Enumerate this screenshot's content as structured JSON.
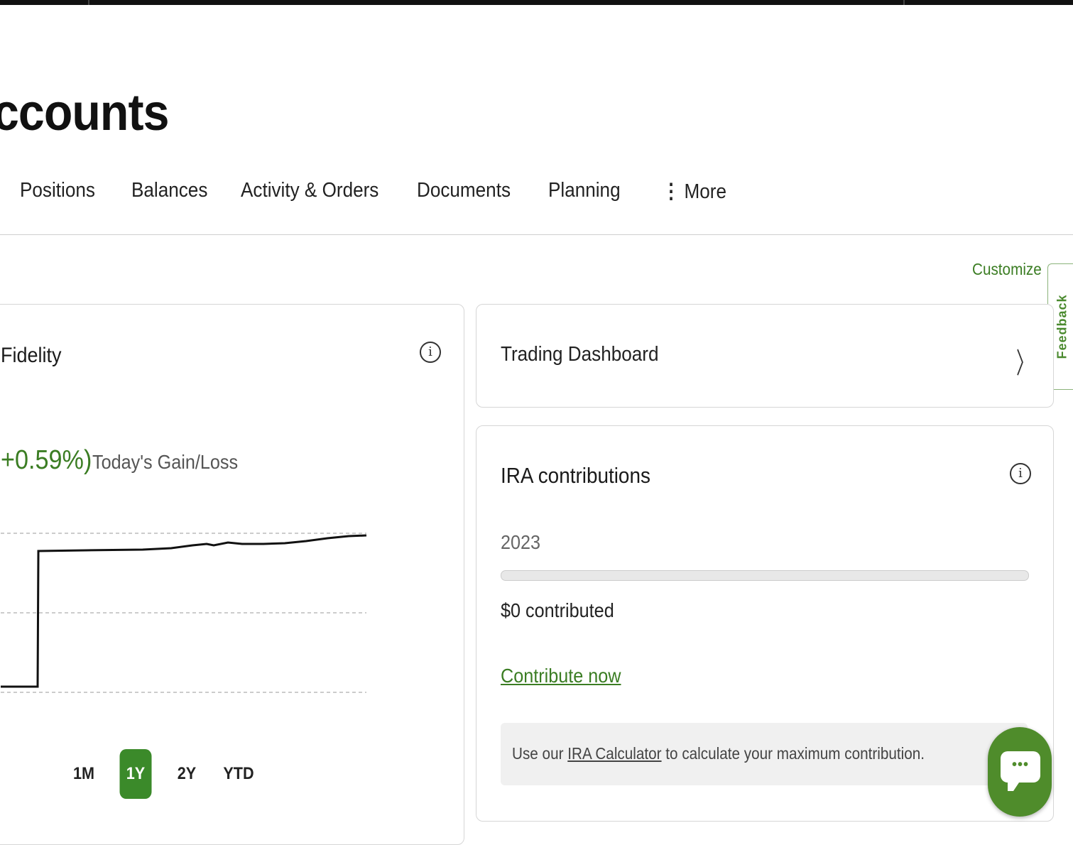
{
  "header": {
    "title": "ccounts"
  },
  "nav": {
    "items": [
      {
        "label": "Positions"
      },
      {
        "label": "Balances"
      },
      {
        "label": "Activity & Orders"
      },
      {
        "label": "Documents"
      },
      {
        "label": "Planning"
      },
      {
        "label": "More"
      }
    ]
  },
  "customize_label": "Customize",
  "feedback_label": "Feedback",
  "account_card": {
    "title": "Fidelity",
    "gain_pct": "+0.59%)",
    "gain_label": "Today's Gain/Loss",
    "range_buttons": [
      "1M",
      "1Y",
      "2Y",
      "YTD"
    ],
    "active_range": "1Y"
  },
  "trading_card": {
    "title": "Trading Dashboard"
  },
  "ira_card": {
    "title": "IRA contributions",
    "year": "2023",
    "progress_fraction": 0,
    "contributed": "$0 contributed",
    "link": "Contribute now",
    "note_prefix": "Use our ",
    "note_link": "IRA Calculator",
    "note_suffix": " to calculate your maximum contribution."
  },
  "colors": {
    "accent_green": "#3b8a2a",
    "link_green": "#3b7d23"
  },
  "icons": {
    "info": "info-icon",
    "chevron": "chevron-right-icon",
    "chat": "chat-icon",
    "more": "more-dots-icon"
  }
}
